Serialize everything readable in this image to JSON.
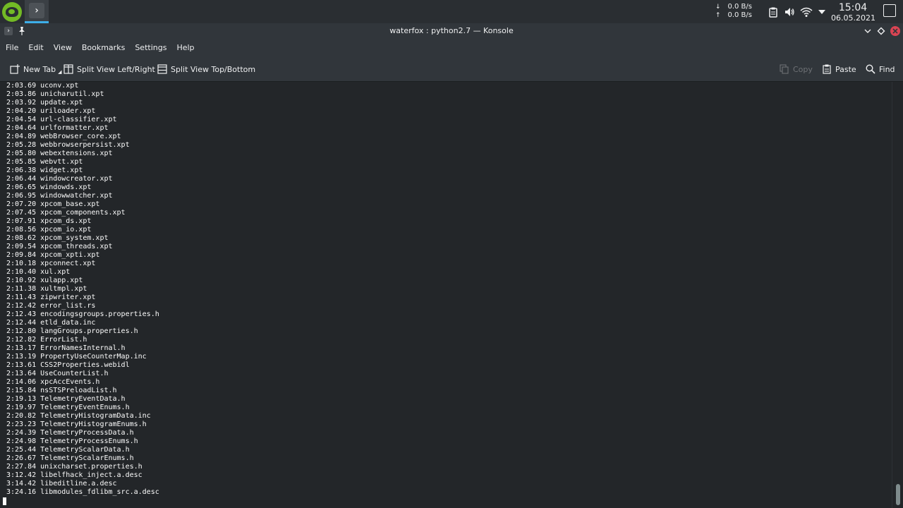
{
  "panel": {
    "net_down": "0.0 B/s",
    "net_up": "0.0 B/s",
    "clock_time": "15:04",
    "clock_date": "06.05.2021",
    "icons": [
      "opensuse-launcher-icon",
      "konsole-task-icon",
      "clipboard-icon",
      "volume-icon",
      "wifi-icon",
      "tray-expand-icon",
      "show-desktop-icon"
    ]
  },
  "window": {
    "title": "waterfox : python2.7 — Konsole"
  },
  "menu": {
    "file": "File",
    "edit": "Edit",
    "view": "View",
    "bookmarks": "Bookmarks",
    "settings": "Settings",
    "help": "Help"
  },
  "toolbar": {
    "new_tab": "New Tab",
    "split_lr": "Split View Left/Right",
    "split_tb": "Split View Top/Bottom",
    "copy": "Copy",
    "paste": "Paste",
    "find": "Find"
  },
  "terminal": {
    "lines": [
      "2:03.69 uconv.xpt",
      "2:03.86 unicharutil.xpt",
      "2:03.92 update.xpt",
      "2:04.20 uriloader.xpt",
      "2:04.54 url-classifier.xpt",
      "2:04.64 urlformatter.xpt",
      "2:04.89 webBrowser_core.xpt",
      "2:05.28 webbrowserpersist.xpt",
      "2:05.80 webextensions.xpt",
      "2:05.85 webvtt.xpt",
      "2:06.38 widget.xpt",
      "2:06.44 windowcreator.xpt",
      "2:06.65 windowds.xpt",
      "2:06.95 windowwatcher.xpt",
      "2:07.20 xpcom_base.xpt",
      "2:07.45 xpcom_components.xpt",
      "2:07.91 xpcom_ds.xpt",
      "2:08.56 xpcom_io.xpt",
      "2:08.62 xpcom_system.xpt",
      "2:09.54 xpcom_threads.xpt",
      "2:09.84 xpcom_xpti.xpt",
      "2:10.18 xpconnect.xpt",
      "2:10.40 xul.xpt",
      "2:10.92 xulapp.xpt",
      "2:11.38 xultmpl.xpt",
      "2:11.43 zipwriter.xpt",
      "2:12.42 error_list.rs",
      "2:12.43 encodingsgroups.properties.h",
      "2:12.44 etld_data.inc",
      "2:12.80 langGroups.properties.h",
      "2:12.82 ErrorList.h",
      "2:13.17 ErrorNamesInternal.h",
      "2:13.19 PropertyUseCounterMap.inc",
      "2:13.61 CSS2Properties.webidl",
      "2:13.64 UseCounterList.h",
      "2:14.06 xpcAccEvents.h",
      "2:15.84 nsSTSPreloadList.h",
      "2:19.13 TelemetryEventData.h",
      "2:19.97 TelemetryEventEnums.h",
      "2:20.82 TelemetryHistogramData.inc",
      "2:23.23 TelemetryHistogramEnums.h",
      "2:24.39 TelemetryProcessData.h",
      "2:24.98 TelemetryProcessEnums.h",
      "2:25.44 TelemetryScalarData.h",
      "2:26.67 TelemetryScalarEnums.h",
      "2:27.84 unixcharset.properties.h",
      "3:12.42 libelfhack_inject.a.desc",
      "3:14.42 libeditline.a.desc",
      "3:24.16 libmodules_fdlibm_src.a.desc"
    ]
  }
}
